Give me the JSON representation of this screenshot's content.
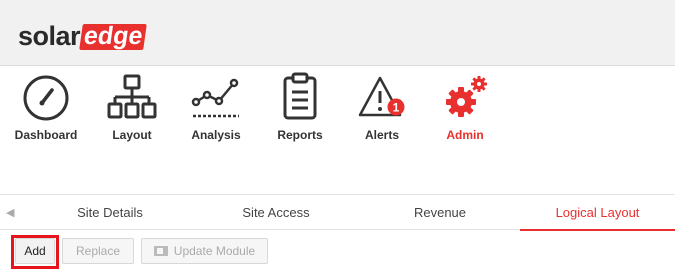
{
  "brand": {
    "logo_part1": "solar",
    "logo_part2": "edge",
    "accent": "#e8312f"
  },
  "nav": {
    "items": [
      {
        "label": "Dashboard",
        "icon": "gauge-icon"
      },
      {
        "label": "Layout",
        "icon": "hierarchy-icon"
      },
      {
        "label": "Analysis",
        "icon": "line-chart-icon"
      },
      {
        "label": "Reports",
        "icon": "clipboard-icon"
      },
      {
        "label": "Alerts",
        "icon": "warning-icon",
        "badge": "1"
      },
      {
        "label": "Admin",
        "icon": "gears-icon",
        "active": true
      }
    ]
  },
  "tabs": {
    "back_icon": "chevron-left-icon",
    "items": [
      {
        "label": "Site Details"
      },
      {
        "label": "Site Access"
      },
      {
        "label": "Revenue"
      },
      {
        "label": "Logical Layout",
        "active": true
      }
    ]
  },
  "toolbar": {
    "add_label": "Add",
    "replace_label": "Replace",
    "update_module_label": "Update Module"
  }
}
